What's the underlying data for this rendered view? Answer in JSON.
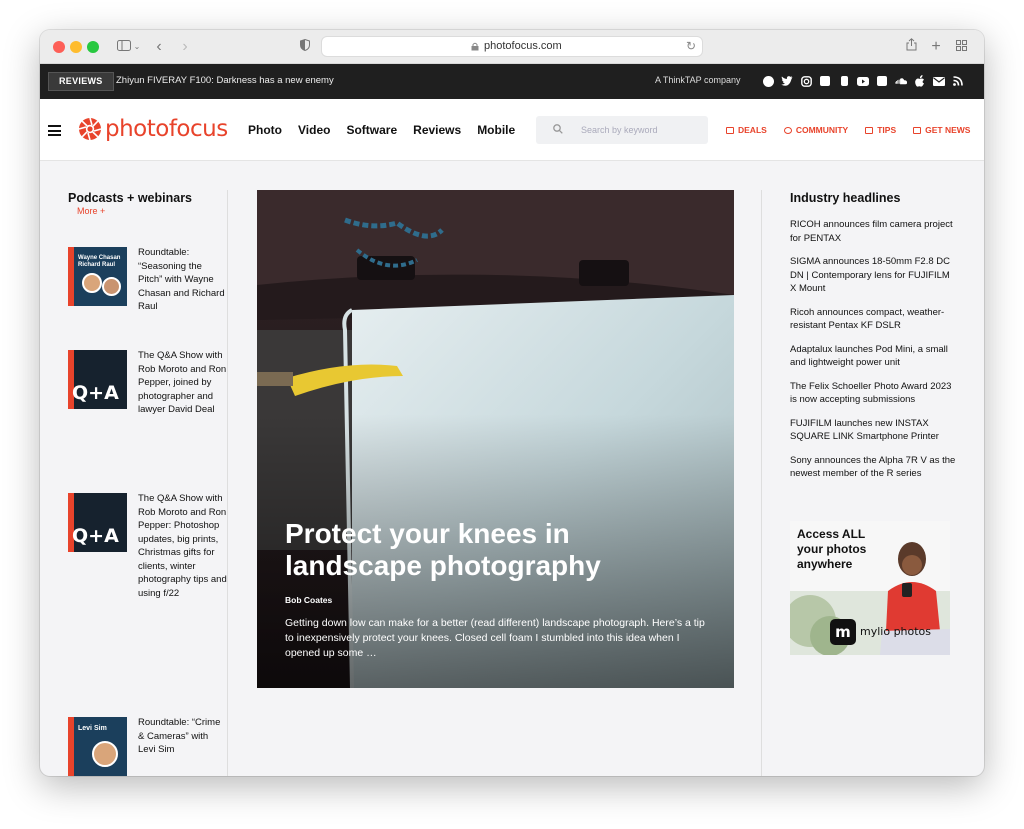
{
  "browser": {
    "url": "photofocus.com"
  },
  "topbar": {
    "badge": "REVIEWS",
    "ticker": "Zhiyun FIVERAY F100: Darkness has a new enemy",
    "company": "A ThinkTAP company",
    "social_icons": [
      "facebook-icon",
      "twitter-icon",
      "instagram-icon",
      "flickr-icon",
      "clubhouse-icon",
      "youtube-icon",
      "flipboard-icon",
      "soundcloud-icon",
      "apple-podcasts-icon",
      "email-icon",
      "rss-icon"
    ]
  },
  "nav": {
    "logo": "photofocus",
    "links": [
      "Photo",
      "Video",
      "Software",
      "Reviews",
      "Mobile"
    ],
    "search_placeholder": "Search by keyword",
    "right_links": [
      "DEALS",
      "COMMUNITY",
      "TIPS",
      "GET NEWS"
    ],
    "accent": "#e8432b"
  },
  "left": {
    "title": "Podcasts + webinars",
    "more": "More +",
    "items": [
      {
        "title": "Roundtable: “Seasoning the Pitch” with Wayne Chasan and Richard Raul",
        "thumb_label": "Wayne Chasan Richard Raul"
      },
      {
        "title": "The Q&A Show with Rob Moroto and Ron Pepper, joined by photographer and lawyer David Deal",
        "thumb_label": "Q+A"
      },
      {
        "title": "The Q&A Show with Rob Moroto and Ron Pepper: Photoshop updates, big prints, Christmas gifts for clients, winter photography tips and using f/22",
        "thumb_label": "Q+A"
      },
      {
        "title": "Roundtable: “Crime & Cameras” with Levi Sim",
        "thumb_label": "Levi Sim"
      }
    ]
  },
  "hero": {
    "title": "Protect your knees in landscape photography",
    "author": "Bob Coates",
    "excerpt": "Getting down low can make for a better (read different) landscape photograph. Here’s a tip to inexpensively protect your knees. Closed cell foam I stumbled into this idea when I opened up some …"
  },
  "right": {
    "title": "Industry headlines",
    "headlines": [
      "RICOH announces film camera project for PENTAX",
      "SIGMA announces 18-50mm F2.8 DC DN | Contemporary lens for FUJIFILM X Mount",
      "Ricoh announces compact, weather-resistant Pentax KF DSLR",
      "Adaptalux launches Pod Mini, a small and lightweight power unit",
      "The Felix Schoeller Photo Award 2023 is now accepting submissions",
      "FUJIFILM launches new INSTAX SQUARE LINK Smartphone Printer",
      "Sony announces the Alpha 7R V as the newest member of the R series"
    ],
    "ad": {
      "text": "Access ALL your photos anywhere",
      "brand": "mylio photos"
    }
  }
}
